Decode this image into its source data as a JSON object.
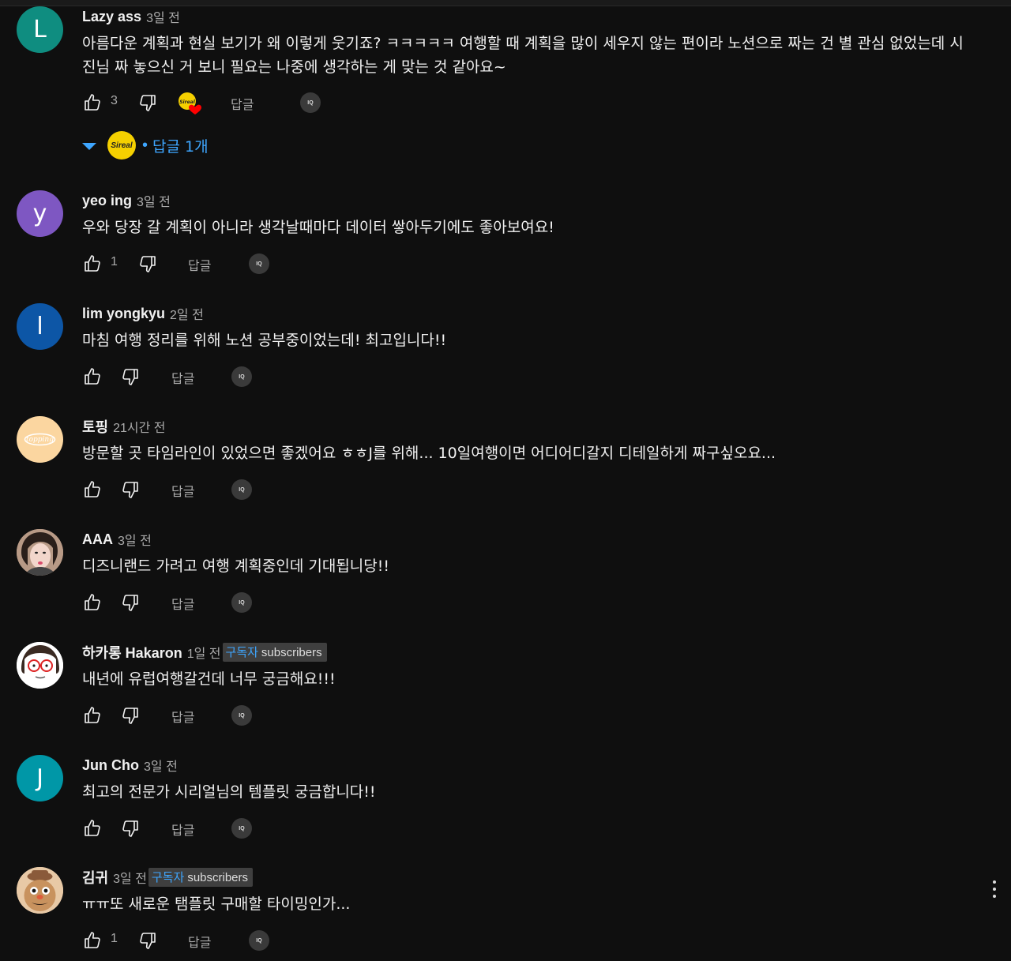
{
  "labels": {
    "reply": "답글",
    "iq": "IQ"
  },
  "comments": [
    {
      "author": "Lazy ass",
      "time": "3일 전",
      "initial": "L",
      "avatar_color": "#0f8d80",
      "text": "아름다운 계획과 현실 보기가 왜 이렇게 웃기죠? ㅋㅋㅋㅋㅋ 여행할 때 계획을 많이 세우지 않는 편이라 노션으로 짜는 건 별 관심 없었는데 시진님 짜 놓으신 거 보니 필요는 나중에 생각하는 게 맞는 것 같아요~",
      "likes": "3",
      "creator_heart": true
    },
    {
      "author": "yeo ing",
      "time": "3일 전",
      "initial": "y",
      "avatar_color": "#7e57c2",
      "text": "우와 당장 갈 계획이 아니라 생각날때마다 데이터 쌓아두기에도 좋아보여요!",
      "likes": "1"
    },
    {
      "author": "lim yongkyu",
      "time": "2일 전",
      "initial": "l",
      "avatar_color": "#0d56a6",
      "text": "마침 여행 정리를 위해 노션 공부중이었는데! 최고입니다!!",
      "likes": ""
    },
    {
      "author": "토핑",
      "time": "21시간 전",
      "initial": "topping",
      "avatar_color": "#fbd6a0",
      "text": "방문할 곳 타임라인이 있었으면 좋겠어요 ㅎㅎJ를 위해... 10일여행이면 어디어디갈지 디테일하게 짜구싶오요...",
      "likes": ""
    },
    {
      "author": "AAA",
      "time": "3일 전",
      "initial": "",
      "avatar_color": "#caa893",
      "text": "디즈니랜드 가려고 여행 계획중인데 기대됩니당!!",
      "likes": ""
    },
    {
      "author": "하카롱 Hakaron",
      "time": "1일 전",
      "initial": "",
      "avatar_color": "#ffffff",
      "badge_kr": "구독자",
      "badge_en": "subscribers",
      "text": "내년에 유럽여행갈건데 너무 궁금해요!!!",
      "likes": ""
    },
    {
      "author": "Jun Cho",
      "time": "3일 전",
      "initial": "J",
      "avatar_color": "#0097a7",
      "text": "최고의 전문가 시리얼님의 템플릿 궁금합니다!!",
      "likes": ""
    },
    {
      "author": "김귀",
      "time": "3일 전",
      "initial": "",
      "avatar_color": "#e8c9a6",
      "badge_kr": "구독자",
      "badge_en": "subscribers",
      "text": "ㅠㅠ또 새로운 탬플릿 구매할 타이밍인가...",
      "likes": "1"
    }
  ],
  "replies": {
    "label": "답글 1개",
    "avatar_text": "Sireal"
  },
  "heart_badge_text": "Sireal",
  "colors": {
    "accent": "#3ea6ff",
    "background": "#0f0f0f",
    "heart": "#ff0000"
  }
}
